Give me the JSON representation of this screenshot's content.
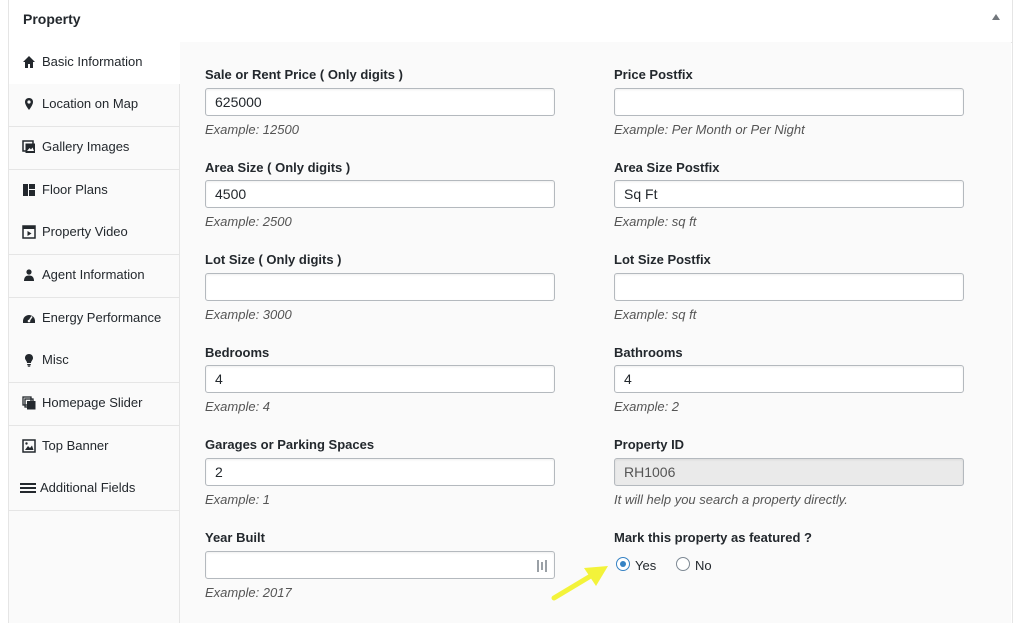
{
  "panel": {
    "title": "Property"
  },
  "sidebar": {
    "items": [
      {
        "label": "Basic Information",
        "icon": "home-icon"
      },
      {
        "label": "Location on Map",
        "icon": "map-pin-icon"
      },
      {
        "label": "Gallery Images",
        "icon": "gallery-icon"
      },
      {
        "label": "Floor Plans",
        "icon": "floor-plans-icon"
      },
      {
        "label": "Property Video",
        "icon": "video-icon"
      },
      {
        "label": "Agent Information",
        "icon": "agent-icon"
      },
      {
        "label": "Energy Performance",
        "icon": "dashboard-icon"
      },
      {
        "label": "Misc",
        "icon": "lightbulb-icon"
      },
      {
        "label": "Homepage Slider",
        "icon": "slider-icon"
      },
      {
        "label": "Top Banner",
        "icon": "image-icon"
      },
      {
        "label": "Additional Fields",
        "icon": "menu-icon"
      }
    ],
    "active": "Basic Information"
  },
  "fields": {
    "price": {
      "label": "Sale or Rent Price ( Only digits )",
      "value": "625000",
      "hint": "Example: 12500"
    },
    "price_postfix": {
      "label": "Price Postfix",
      "value": "",
      "hint": "Example: Per Month or Per Night"
    },
    "area_size": {
      "label": "Area Size ( Only digits )",
      "value": "4500",
      "hint": "Example: 2500"
    },
    "area_postfix": {
      "label": "Area Size Postfix",
      "value": "Sq Ft",
      "hint": "Example: sq ft"
    },
    "lot_size": {
      "label": "Lot Size ( Only digits )",
      "value": "",
      "hint": "Example: 3000"
    },
    "lot_postfix": {
      "label": "Lot Size Postfix",
      "value": "",
      "hint": "Example: sq ft"
    },
    "bedrooms": {
      "label": "Bedrooms",
      "value": "4",
      "hint": "Example: 4"
    },
    "bathrooms": {
      "label": "Bathrooms",
      "value": "4",
      "hint": "Example: 2"
    },
    "garages": {
      "label": "Garages or Parking Spaces",
      "value": "2",
      "hint": "Example: 1"
    },
    "property_id": {
      "label": "Property ID",
      "value": "RH1006",
      "hint": "It will help you search a property directly."
    },
    "year_built": {
      "label": "Year Built",
      "value": "",
      "hint": "Example: 2017"
    }
  },
  "featured": {
    "label": "Mark this property as featured ?",
    "options": [
      "Yes",
      "No"
    ],
    "selected": "Yes"
  },
  "colors": {
    "accent": "#3582c4",
    "arrow": "#f3f33a"
  }
}
